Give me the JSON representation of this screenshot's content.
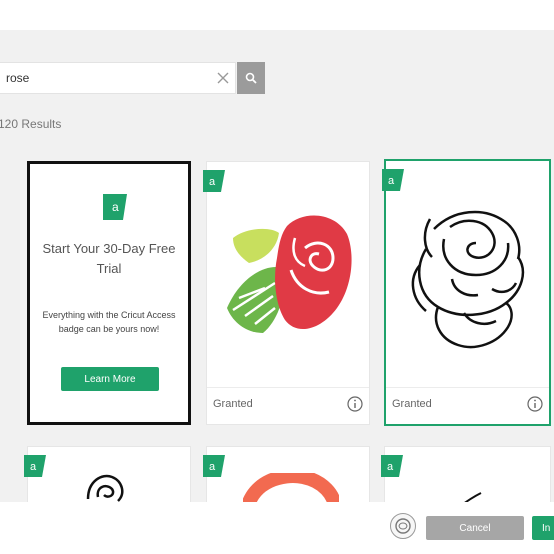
{
  "search": {
    "query": "rose"
  },
  "results_label": "120 Results",
  "promo": {
    "title": "Start Your 30-Day Free Trial",
    "body": "Everything with the Cricut Access badge can be yours now!",
    "button": "Learn More"
  },
  "cards": [
    {
      "label": "Granted",
      "image": "red-rose-with-leaves"
    },
    {
      "label": "Granted",
      "image": "black-outline-rose"
    }
  ],
  "footer": {
    "cancel": "Cancel",
    "insert": "In"
  },
  "colors": {
    "access_green": "#1fa26b",
    "rose_red": "#e03a45",
    "leaf_green": "#7bbf4a",
    "selected_border": "#1fa26b"
  },
  "icons": [
    "search-icon",
    "clear-icon",
    "access-badge-icon",
    "info-icon",
    "avatar"
  ]
}
